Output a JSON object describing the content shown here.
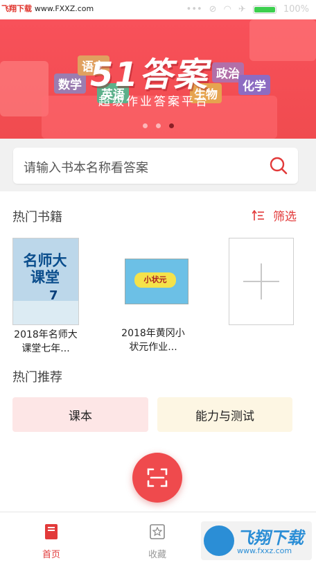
{
  "watermark_top": {
    "site_name": "飞翔下载",
    "url": "www.FXXZ.com"
  },
  "status_bar": {
    "battery_text": "100%"
  },
  "banner": {
    "title": "51答案",
    "subtitle": "超级作业答案平台",
    "subjects": [
      "数学",
      "语文",
      "英语",
      "政治",
      "化学",
      "生物"
    ],
    "page_count": 3,
    "active_page": 3
  },
  "search": {
    "placeholder": "请输入书本名称看答案"
  },
  "hot_books": {
    "title": "热门书籍",
    "filter_label": "筛选",
    "books": [
      {
        "title": "2018年名师大课堂七年...",
        "cover_text": "名师大课堂",
        "cover_grade": "7"
      },
      {
        "title": "2018年黄冈小状元作业...",
        "cover_text": "小状元"
      }
    ]
  },
  "recommend": {
    "title": "热门推荐",
    "items": [
      {
        "label": "课本"
      },
      {
        "label": "能力与测试"
      }
    ]
  },
  "tabbar": {
    "items": [
      {
        "label": "首页",
        "active": true
      },
      {
        "label": "收藏",
        "active": false
      }
    ]
  },
  "watermark_bottom": {
    "brand": "飞翔下载",
    "url": "www.fxxz.com"
  },
  "colors": {
    "accent": "#ef4a4d",
    "banner": "#f4505a",
    "tile_pink": "#fde6e6",
    "tile_cream": "#fdf6e3"
  }
}
